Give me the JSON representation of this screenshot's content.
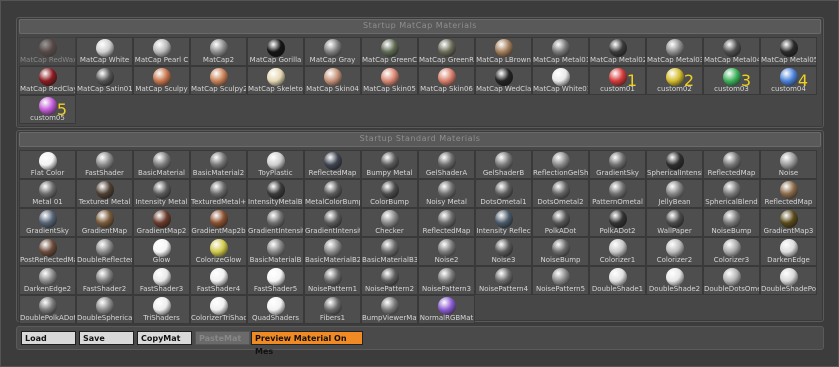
{
  "startup_matcap": {
    "title": "Startup MatCap Materials",
    "items": [
      {
        "label": "MatCap RedWax",
        "color": "#6a4a44",
        "faded": true
      },
      {
        "label": "MatCap White",
        "color": "#cfcfcf"
      },
      {
        "label": "MatCap Pearl C",
        "color": "#b9b9b9"
      },
      {
        "label": "MatCap2",
        "color": "#8d8d8d"
      },
      {
        "label": "MatCap Gorilla",
        "color": "#141414"
      },
      {
        "label": "MatCap Gray",
        "color": "#7e7e7e"
      },
      {
        "label": "MatCap GreenC",
        "color": "#5e6a53"
      },
      {
        "label": "MatCap GreenR",
        "color": "#6b6b58"
      },
      {
        "label": "MatCap LBrown",
        "color": "#a37d5a"
      },
      {
        "label": "MatCap Metal01",
        "color": "#787878"
      },
      {
        "label": "MatCap Metal02",
        "color": "#3a3a3a"
      },
      {
        "label": "MatCap Metal03",
        "color": "#8e8e8e"
      },
      {
        "label": "MatCap Metal04",
        "color": "#4e4e4e"
      },
      {
        "label": "MatCap Metal05",
        "color": "#2a2a2a"
      },
      {
        "label": "MatCap RedClay",
        "color": "#8a1c22"
      },
      {
        "label": "MatCap Satin01",
        "color": "#545454"
      },
      {
        "label": "MatCap Sculpy",
        "color": "#c7764d"
      },
      {
        "label": "MatCap Sculpy2",
        "color": "#c98257"
      },
      {
        "label": "MatCap Skeleton",
        "color": "#e6d8b3"
      },
      {
        "label": "MatCap Skin04",
        "color": "#c49278"
      },
      {
        "label": "MatCap Skin05",
        "color": "#d98873"
      },
      {
        "label": "MatCap Skin06",
        "color": "#d87e6c"
      },
      {
        "label": "MatCap WedCla",
        "color": "#232323"
      },
      {
        "label": "MatCap White01",
        "color": "#e8e8e8"
      },
      {
        "label": "custom01",
        "color": "#d63a3a",
        "num": "1"
      },
      {
        "label": "custom02",
        "color": "#d4bd2d",
        "num": "2"
      },
      {
        "label": "custom03",
        "color": "#3db25b",
        "num": "3"
      },
      {
        "label": "custom04",
        "color": "#4c82d9",
        "num": "4"
      },
      {
        "label": "custom05",
        "color": "#c25ad6",
        "num": "5"
      }
    ]
  },
  "startup_standard": {
    "title": "Startup Standard Materials",
    "items": [
      {
        "label": "Flat Color",
        "color": "#f3f3f3"
      },
      {
        "label": "FastShader",
        "color": "#8a8a8a"
      },
      {
        "label": "BasicMaterial",
        "color": "#7d7d7d"
      },
      {
        "label": "BasicMaterial2",
        "color": "#787878"
      },
      {
        "label": "ToyPlastic",
        "color": "#cfcfcf"
      },
      {
        "label": "ReflectedMap",
        "color": "#3e4450"
      },
      {
        "label": "Bumpy Metal",
        "color": "#5a5a5a"
      },
      {
        "label": "GelShaderA",
        "color": "#6c6c6c"
      },
      {
        "label": "GelShaderB",
        "color": "#7a7a7a"
      },
      {
        "label": "ReflectionGelSha",
        "color": "#8a8a8a"
      },
      {
        "label": "GradientSky",
        "color": "#6f6f6f"
      },
      {
        "label": "SphericalIntensit",
        "color": "#2e2e2e"
      },
      {
        "label": "ReflectedMap",
        "color": "#777777"
      },
      {
        "label": "Noise",
        "color": "#9a9a9a"
      },
      {
        "label": "Metal 01",
        "color": "#6c6c6c"
      },
      {
        "label": "Textured Metal",
        "color": "#4e3f33"
      },
      {
        "label": "Intensity Metal",
        "color": "#5a5a5a"
      },
      {
        "label": "TexturedMetal+",
        "color": "#6a6a6a"
      },
      {
        "label": "IntensityMetalBu",
        "color": "#3a3a3a"
      },
      {
        "label": "MetalColorBump",
        "color": "#5a5a5a"
      },
      {
        "label": "ColorBump",
        "color": "#4a4a4a"
      },
      {
        "label": "Noisy Metal",
        "color": "#6f6f6f"
      },
      {
        "label": "DotsOmetal1",
        "color": "#5e5e5e"
      },
      {
        "label": "DotsOmetal2",
        "color": "#646464"
      },
      {
        "label": "PatternOmetal",
        "color": "#707070"
      },
      {
        "label": "JellyBean",
        "color": "#858585"
      },
      {
        "label": "SphericalBlend",
        "color": "#7a7a7a"
      },
      {
        "label": "ReflectedMap",
        "color": "#8a6a4a"
      },
      {
        "label": "GradientSky",
        "color": "#566476"
      },
      {
        "label": "GradientMap",
        "color": "#7a5a3a"
      },
      {
        "label": "GradientMap2",
        "color": "#6a3a2a"
      },
      {
        "label": "GradientMap2b",
        "color": "#8a5030"
      },
      {
        "label": "GradientIntensity",
        "color": "#707070"
      },
      {
        "label": "GradientIntensity",
        "color": "#5a5a5a"
      },
      {
        "label": "Checker",
        "color": "#8a8a8a"
      },
      {
        "label": "ReflectedMap",
        "color": "#6a6a6a"
      },
      {
        "label": "Intensity Reflec",
        "color": "#4a5a6a"
      },
      {
        "label": "PolkADot",
        "color": "#565656"
      },
      {
        "label": "PolkADot2",
        "color": "#333333"
      },
      {
        "label": "WallPaper",
        "color": "#4a4a4a"
      },
      {
        "label": "NoiseBump",
        "color": "#7a7a7a"
      },
      {
        "label": "GradientMap3",
        "color": "#5a4a1a"
      },
      {
        "label": "PostReflectedMa",
        "color": "#6a4a3a"
      },
      {
        "label": "DoubleReflected",
        "color": "#8a8a8a"
      },
      {
        "label": "Glow",
        "color": "#f5f5f5"
      },
      {
        "label": "ColorizeGlow",
        "color": "#d0c84a"
      },
      {
        "label": "BasicMaterialB",
        "color": "#858585"
      },
      {
        "label": "BasicMaterialB2",
        "color": "#8a8a8a"
      },
      {
        "label": "BasicMaterialB3",
        "color": "#6a6a6a"
      },
      {
        "label": "Noise2",
        "color": "#7a7a7a"
      },
      {
        "label": "Noise3",
        "color": "#5a5a5a"
      },
      {
        "label": "NoiseBump",
        "color": "#6a6a6a"
      },
      {
        "label": "Colorizer1",
        "color": "#c8c8c8"
      },
      {
        "label": "Colorizer2",
        "color": "#bdbdbd"
      },
      {
        "label": "Colorizer3",
        "color": "#aaaaaa"
      },
      {
        "label": "DarkenEdge",
        "color": "#dcdcdc"
      },
      {
        "label": "DarkenEdge2",
        "color": "#8a8a8a"
      },
      {
        "label": "FastShader2",
        "color": "#7e7e7e"
      },
      {
        "label": "FastShader3",
        "color": "#e8e8e8"
      },
      {
        "label": "FastShader4",
        "color": "#f0f0f0"
      },
      {
        "label": "FastShader5",
        "color": "#f5f5f5"
      },
      {
        "label": "NoisePattern1",
        "color": "#6a6a6a"
      },
      {
        "label": "NoisePattern2",
        "color": "#5e5e5e"
      },
      {
        "label": "NoisePattern3",
        "color": "#7a7a7a"
      },
      {
        "label": "NoisePattern4",
        "color": "#6a6a6a"
      },
      {
        "label": "NoisePattern5",
        "color": "#8a8a8a"
      },
      {
        "label": "DoubleShade1",
        "color": "#e0e0e0"
      },
      {
        "label": "DoubleShade2",
        "color": "#e6e6e6"
      },
      {
        "label": "DoubleDotsOmet",
        "color": "#b5b5b5"
      },
      {
        "label": "DoubleShadePolk",
        "color": "#d8d8d8"
      },
      {
        "label": "DoublePolkADot",
        "color": "#777777"
      },
      {
        "label": "DoubleSpherical",
        "color": "#8a8a8a"
      },
      {
        "label": "TriShaders",
        "color": "#ececec"
      },
      {
        "label": "ColorizerTriShad",
        "color": "#efefef"
      },
      {
        "label": "QuadShaders",
        "color": "#f2f2f2"
      },
      {
        "label": "Fibers1",
        "color": "#6a6a6a"
      },
      {
        "label": "BumpViewerMat",
        "color": "#7a7a7a"
      },
      {
        "label": "NormalRGBMat",
        "color": "#8a5ad0"
      }
    ]
  },
  "toolbar": {
    "load_label": "Load",
    "save_label": "Save",
    "copymat_label": "CopyMat",
    "pastemat_label": "PasteMat",
    "preview_label": "Preview Material On Mes"
  }
}
